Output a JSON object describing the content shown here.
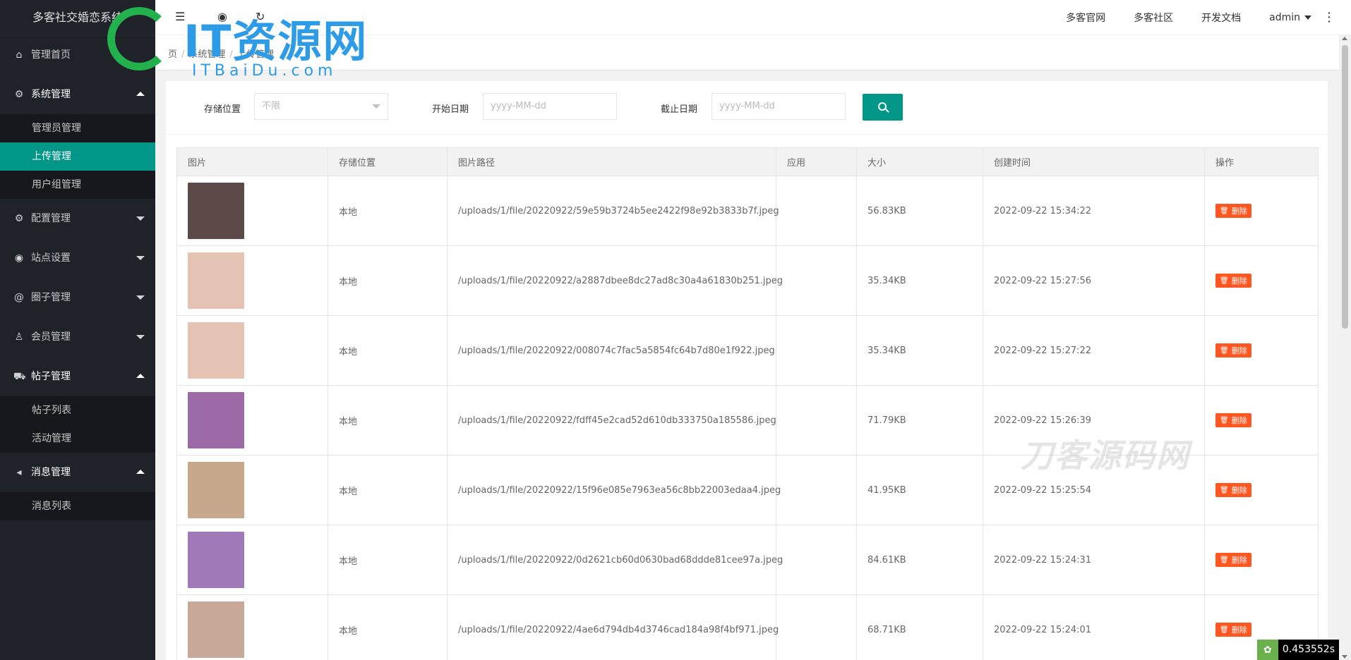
{
  "app": {
    "title": "多客社交婚恋系统"
  },
  "header": {
    "links": [
      "多客官网",
      "多客社区",
      "开发文档"
    ],
    "user": "admin"
  },
  "breadcrumb": [
    "页",
    "系统管理",
    "上传管理"
  ],
  "sidebar": {
    "items": [
      {
        "label": "管理首页",
        "icon": "home-icon"
      },
      {
        "label": "系统管理",
        "icon": "gear-icon",
        "open": true,
        "children": [
          "管理员管理",
          "上传管理",
          "用户组管理"
        ],
        "active_child": "上传管理"
      },
      {
        "label": "配置管理",
        "icon": "gear-icon"
      },
      {
        "label": "站点设置",
        "icon": "palette-icon"
      },
      {
        "label": "圈子管理",
        "icon": "at-icon"
      },
      {
        "label": "会员管理",
        "icon": "user-icon"
      },
      {
        "label": "帖子管理",
        "icon": "cart-icon",
        "open": true,
        "children": [
          "帖子列表",
          "活动管理"
        ]
      },
      {
        "label": "消息管理",
        "icon": "speaker-icon",
        "open": true,
        "children": [
          "消息列表"
        ]
      }
    ]
  },
  "filter": {
    "storage_label": "存储位置",
    "storage_value": "不限",
    "start_label": "开始日期",
    "start_placeholder": "yyyy-MM-dd",
    "end_label": "截止日期",
    "end_placeholder": "yyyy-MM-dd"
  },
  "table": {
    "columns": [
      "图片",
      "存储位置",
      "图片路径",
      "应用",
      "大小",
      "创建时间",
      "操作"
    ],
    "delete_label": "删除",
    "rows": [
      {
        "storage": "本地",
        "path": "/uploads/1/file/20220922/59e59b3724b5ee2422f98e92b3833b7f.jpeg",
        "app": "",
        "size": "56.83KB",
        "created": "2022-09-22 15:34:22",
        "thumb_color": "#5b4a48"
      },
      {
        "storage": "本地",
        "path": "/uploads/1/file/20220922/a2887dbee8dc27ad8c30a4a61830b251.jpeg",
        "app": "",
        "size": "35.34KB",
        "created": "2022-09-22 15:27:56",
        "thumb_color": "#e4c2b4"
      },
      {
        "storage": "本地",
        "path": "/uploads/1/file/20220922/008074c7fac5a5854fc64b7d80e1f922.jpeg",
        "app": "",
        "size": "35.34KB",
        "created": "2022-09-22 15:27:22",
        "thumb_color": "#e4c2b4"
      },
      {
        "storage": "本地",
        "path": "/uploads/1/file/20220922/fdff45e2cad52d610db333750a185586.jpeg",
        "app": "",
        "size": "71.79KB",
        "created": "2022-09-22 15:26:39",
        "thumb_color": "#9d6aa8"
      },
      {
        "storage": "本地",
        "path": "/uploads/1/file/20220922/15f96e085e7963ea56c8bb22003edaa4.jpeg",
        "app": "",
        "size": "41.95KB",
        "created": "2022-09-22 15:25:54",
        "thumb_color": "#c7a88c"
      },
      {
        "storage": "本地",
        "path": "/uploads/1/file/20220922/0d2621cb60d0630bad68ddde81cee97a.jpeg",
        "app": "",
        "size": "84.61KB",
        "created": "2022-09-22 15:24:31",
        "thumb_color": "#a07ab8"
      },
      {
        "storage": "本地",
        "path": "/uploads/1/file/20220922/4ae6d794db4d3746cad184a98f4bf971.jpeg",
        "app": "",
        "size": "68.71KB",
        "created": "2022-09-22 15:24:01",
        "thumb_color": "#c8a896"
      }
    ]
  },
  "watermark": {
    "logo_text": "IT资源网",
    "logo_sub": "ITBaiDu.com",
    "text2": "刀客源码网"
  },
  "timer": "0.453552s",
  "colors": {
    "accent": "#009688",
    "danger": "#ff5722",
    "sidebar": "#20222a"
  }
}
